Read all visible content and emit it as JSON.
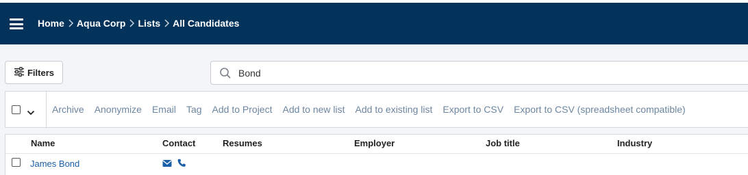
{
  "header": {
    "breadcrumb": [
      "Home",
      "Aqua Corp",
      "Lists",
      "All Candidates"
    ],
    "bg_color": "#03325a"
  },
  "toolbar": {
    "filters_label": "Filters",
    "search_value": "Bond",
    "search_icon": "search-icon",
    "filters_icon": "sliders-icon"
  },
  "actions": [
    "Archive",
    "Anonymize",
    "Email",
    "Tag",
    "Add to Project",
    "Add to new list",
    "Add to existing list",
    "Export to CSV",
    "Export to CSV (spreadsheet compatible)"
  ],
  "table": {
    "columns": [
      "Name",
      "Contact",
      "Resumes",
      "Employer",
      "Job title",
      "Industry"
    ],
    "rows": [
      {
        "name": "James Bond",
        "contact_icons": [
          "envelope-icon",
          "phone-icon"
        ]
      }
    ]
  },
  "colors": {
    "link": "#1a5fa8",
    "action_text": "#6d86a0"
  }
}
